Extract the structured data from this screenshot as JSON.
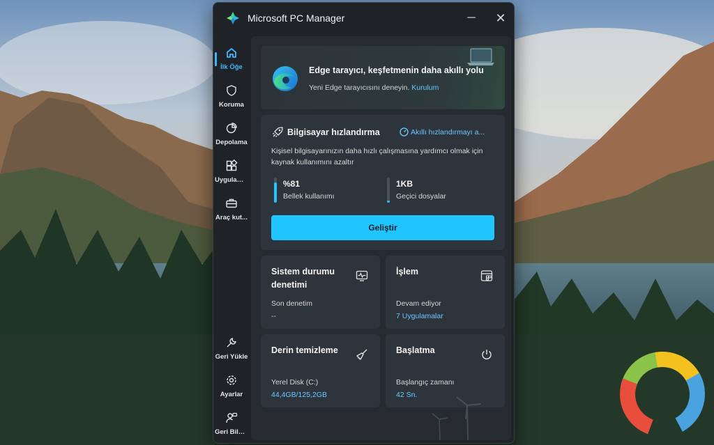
{
  "window": {
    "title": "Microsoft PC Manager",
    "minimize": "─",
    "close": "✕"
  },
  "nav": [
    {
      "label": "İlk Öğe",
      "icon": "home-icon",
      "active": true
    },
    {
      "label": "Koruma",
      "icon": "shield-icon"
    },
    {
      "label": "Depolama",
      "icon": "pie-chart-icon"
    },
    {
      "label": "Uygulam...",
      "icon": "apps-icon"
    },
    {
      "label": "Araç kut...",
      "icon": "toolbox-icon"
    },
    {
      "label": "Geri Yükle",
      "icon": "wrench-icon"
    },
    {
      "label": "Ayarlar",
      "icon": "gear-icon"
    },
    {
      "label": "Geri Bildi...",
      "icon": "feedback-icon"
    }
  ],
  "edge_card": {
    "title": "Edge tarayıcı, keşfetmenin daha akıllı yolu",
    "subtitle": "Yeni Edge tarayıcısını deneyin.",
    "link": "Kurulum"
  },
  "boost": {
    "title": "Bilgisayar hızlandırma",
    "smart_link": "Akıllı hızlandırmayı a...",
    "description": "Kişisel bilgisayarınızın daha hızlı çalışmasına yardımcı olmak için kaynak kullanımını azaltır",
    "memory": {
      "value": "%81",
      "label": "Bellek kullanımı",
      "fill_pct": 81
    },
    "temp": {
      "value": "1KB",
      "label": "Geçici dosyalar",
      "fill_pct": 8
    },
    "button": "Geliştir"
  },
  "tiles": {
    "health": {
      "title": "Sistem durumu denetimi",
      "label": "Son denetim",
      "value": "--",
      "icon": "health-monitor-icon"
    },
    "process": {
      "title": "İşlem",
      "label": "Devam ediyor",
      "value": "7 Uygulamalar",
      "icon": "process-icon"
    },
    "cleanup": {
      "title": "Derin temizleme",
      "label": "Yerel Disk (C:)",
      "value": "44,4GB/125,2GB",
      "icon": "broom-icon"
    },
    "startup": {
      "title": "Başlatma",
      "label": "Başlangıç zamanı",
      "value": "42 Sn.",
      "icon": "power-icon"
    }
  },
  "colors": {
    "accent": "#1fc5ff",
    "link": "#6cc8ff",
    "window_bg": "#1f2328",
    "card_bg": "#2e343b"
  }
}
